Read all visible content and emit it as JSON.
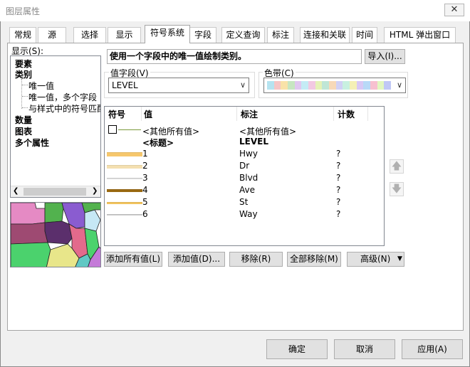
{
  "window": {
    "title": "图层属性",
    "close_glyph": "✕"
  },
  "tabs": [
    {
      "label": "常规"
    },
    {
      "label": "源"
    },
    {
      "label": "选择"
    },
    {
      "label": "显示"
    },
    {
      "label": "符号系统"
    },
    {
      "label": "字段"
    },
    {
      "label": "定义查询"
    },
    {
      "label": "标注"
    },
    {
      "label": "连接和关联"
    },
    {
      "label": "时间"
    },
    {
      "label": "HTML 弹出窗口"
    }
  ],
  "show_label": "显示(S):",
  "tree": {
    "items": [
      {
        "label": "要素",
        "bold": true
      },
      {
        "label": "类别",
        "bold": true
      },
      {
        "label": "唯一值",
        "bold": false
      },
      {
        "label": "唯一值，多个字段",
        "bold": false
      },
      {
        "label": "与样式中的符号匹配",
        "bold": false
      },
      {
        "label": "数量",
        "bold": true
      },
      {
        "label": "图表",
        "bold": true
      },
      {
        "label": "多个属性",
        "bold": true
      }
    ]
  },
  "description": "使用一个字段中的唯一值绘制类别。",
  "import_button": "导入(I)...",
  "value_field": {
    "label": "值字段(V)",
    "value": "LEVEL"
  },
  "color_ramp": {
    "label": "色带(C)",
    "colors": [
      "#b5e3f0",
      "#f5c6c6",
      "#f9e2a8",
      "#c7e6c1",
      "#e0c8f0",
      "#c4ebf5",
      "#f2c9e2",
      "#e5f2b7",
      "#bfe6d6",
      "#f7d9b8",
      "#d1d1f5",
      "#c8f0e0",
      "#f5f0b5",
      "#d9c8f5",
      "#b8d9f7",
      "#f7c0d0",
      "#e2f7c0",
      "#c0c8f5"
    ]
  },
  "table": {
    "headers": {
      "symbol": "符号",
      "value": "值",
      "label": "标注",
      "count": "计数"
    },
    "all_other": {
      "value": "<其他所有值>",
      "label": "<其他所有值>",
      "count": ""
    },
    "heading": {
      "value": "<标题>",
      "label": "LEVEL",
      "count": ""
    },
    "rows": [
      {
        "value": "1",
        "label": "Hwy",
        "count": "?",
        "color": "#f6c76c",
        "weight": 5
      },
      {
        "value": "2",
        "label": "Dr",
        "count": "?",
        "color": "#f4e0b0",
        "weight": 4
      },
      {
        "value": "3",
        "label": "Blvd",
        "count": "?",
        "color": "#dddddd",
        "weight": 1
      },
      {
        "value": "4",
        "label": "Ave",
        "count": "?",
        "color": "#9a6a12",
        "weight": 3
      },
      {
        "value": "5",
        "label": "St",
        "count": "?",
        "color": "#f2c45e",
        "weight": 2
      },
      {
        "value": "6",
        "label": "Way",
        "count": "?",
        "color": "#cccccc",
        "weight": 1
      }
    ]
  },
  "side_arrows": {
    "up": "🡅",
    "down": "🡇"
  },
  "action_buttons": {
    "add_all": "添加所有值(L)",
    "add_values": "添加值(D)...",
    "remove": "移除(R)",
    "remove_all": "全部移除(M)",
    "advanced": "高级(N)"
  },
  "dialog_buttons": {
    "ok": "确定",
    "cancel": "取消",
    "apply": "应用(A)"
  }
}
